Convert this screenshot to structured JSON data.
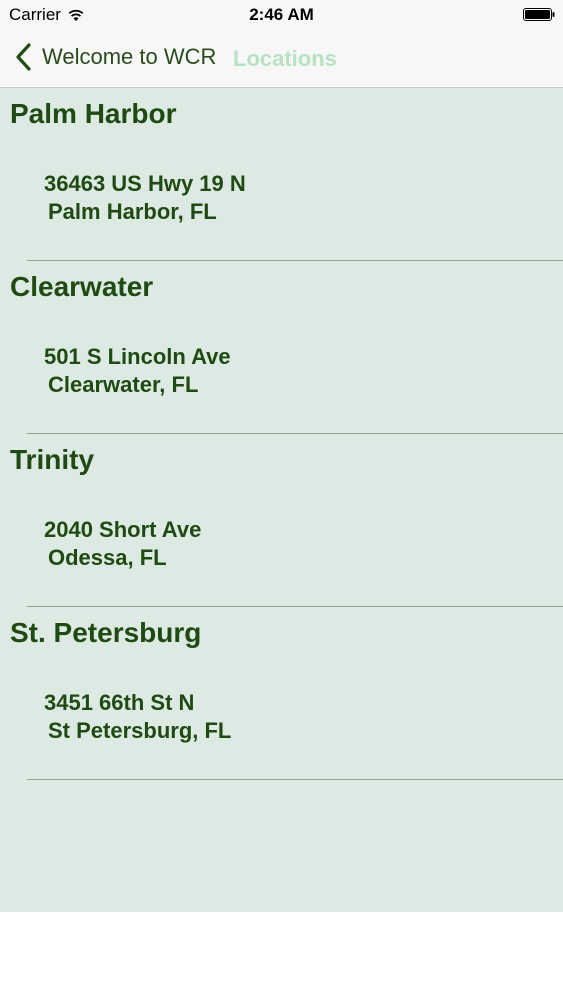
{
  "status_bar": {
    "carrier": "Carrier",
    "time": "2:46 AM"
  },
  "nav": {
    "back_label": "Welcome to WCR",
    "title": "Locations"
  },
  "locations": [
    {
      "name": "Palm Harbor",
      "address": "36463 US Hwy 19 N",
      "city": "Palm Harbor, FL"
    },
    {
      "name": "Clearwater",
      "address": "501 S Lincoln Ave",
      "city": "Clearwater, FL"
    },
    {
      "name": "Trinity",
      "address": "2040 Short Ave",
      "city": "Odessa, FL"
    },
    {
      "name": "St. Petersburg",
      "address": "3451 66th St N",
      "city": "St Petersburg, FL"
    }
  ],
  "colors": {
    "accent": "#1f4a12",
    "title_tint": "#b9e2c2",
    "list_background": "#dde9e3"
  },
  "icons": {
    "wifi": "wifi-icon",
    "battery": "battery-icon",
    "back": "chevron-left-icon"
  }
}
